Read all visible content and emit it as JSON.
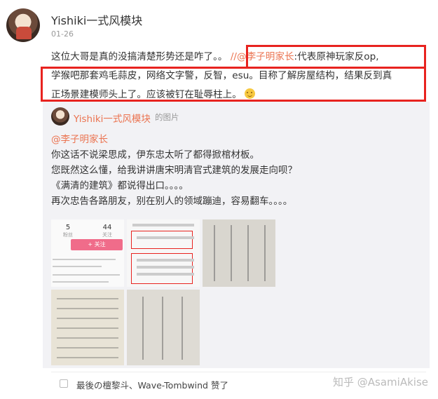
{
  "post": {
    "author": "Yishiki一式风模块",
    "date": "01-26",
    "content_line1_a": "这位大哥是真的没搞清楚形势还是咋了。。",
    "content_line1_b": "//",
    "content_mention": "@李子明家长",
    "content_line1_c": ":代表原神玩家反op,",
    "content_line2": "学猴吧那套鸡毛蒜皮，网络文字警，反智，esu。目称了解房屋结构，结果反到真",
    "content_line3": "正场景建模师头上了。应该被钉在耻辱柱上。",
    "emoji": "smirk-emoji"
  },
  "repost": {
    "author": "Yishiki一式风模块",
    "meta": "的图片",
    "mention": "@李子明家长",
    "lines": [
      "你这话不说梁思成，伊东忠太听了都得掀棺材板。",
      "您既然这么懂，给我讲讲唐宋明清官式建筑的发展走向呗？",
      "《满清的建筑》都说得出口。。。。",
      "再次忠告各路朋友，别在别人的领域蹦迪，容易翻车。。。。"
    ],
    "thumb1": {
      "stat1_value": "5",
      "stat1_label": "粉丝",
      "stat2_value": "44",
      "stat2_label": "关注",
      "follow_label": "+ 关注"
    }
  },
  "likes": {
    "text": "最後の檀黎斗、Wave-Tombwind 赞了"
  },
  "watermark": "知乎 @AsamiAkise",
  "colors": {
    "mention": "#eb7350",
    "highlight": "#e8231f",
    "repost_bg": "#f2f2f5"
  }
}
